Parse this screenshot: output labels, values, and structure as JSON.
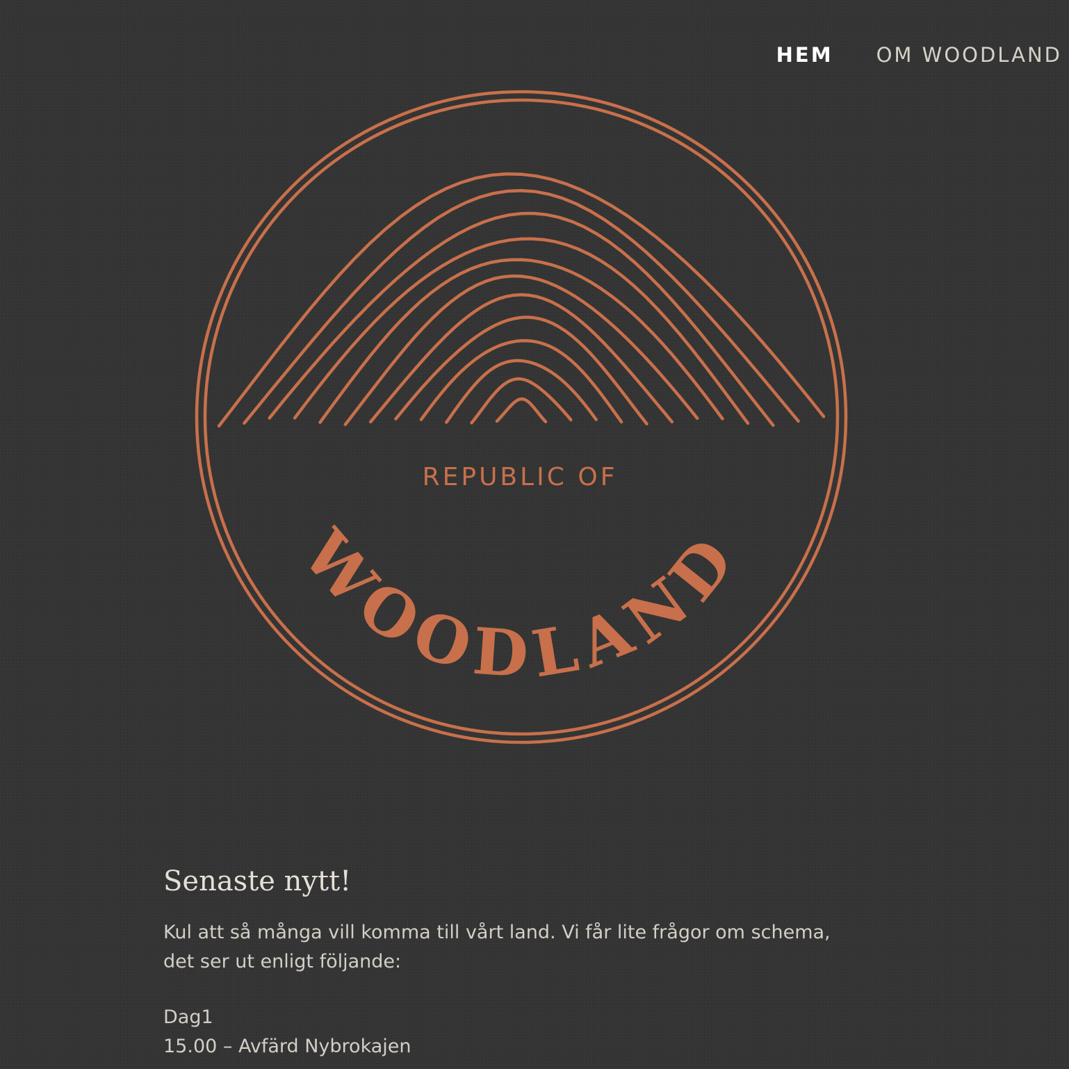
{
  "nav": {
    "items": [
      {
        "label": "HEM",
        "active": true
      },
      {
        "label": "OM WOODLAND",
        "active": false
      }
    ]
  },
  "logo": {
    "text_small": "REPUBLIC OF",
    "text_big": "WOODLAND",
    "color": "#c8704b"
  },
  "news": {
    "heading": "Senaste nytt!",
    "intro": "Kul att så många vill komma till vårt land. Vi får lite frågor om schema, det ser ut enligt följande:",
    "day_label": "Dag1",
    "lines": [
      "15.00 – Avfärd  Nybrokajen"
    ]
  },
  "colors": {
    "background": "#333333",
    "accent": "#c8704b",
    "text": "#d3cfc6"
  }
}
